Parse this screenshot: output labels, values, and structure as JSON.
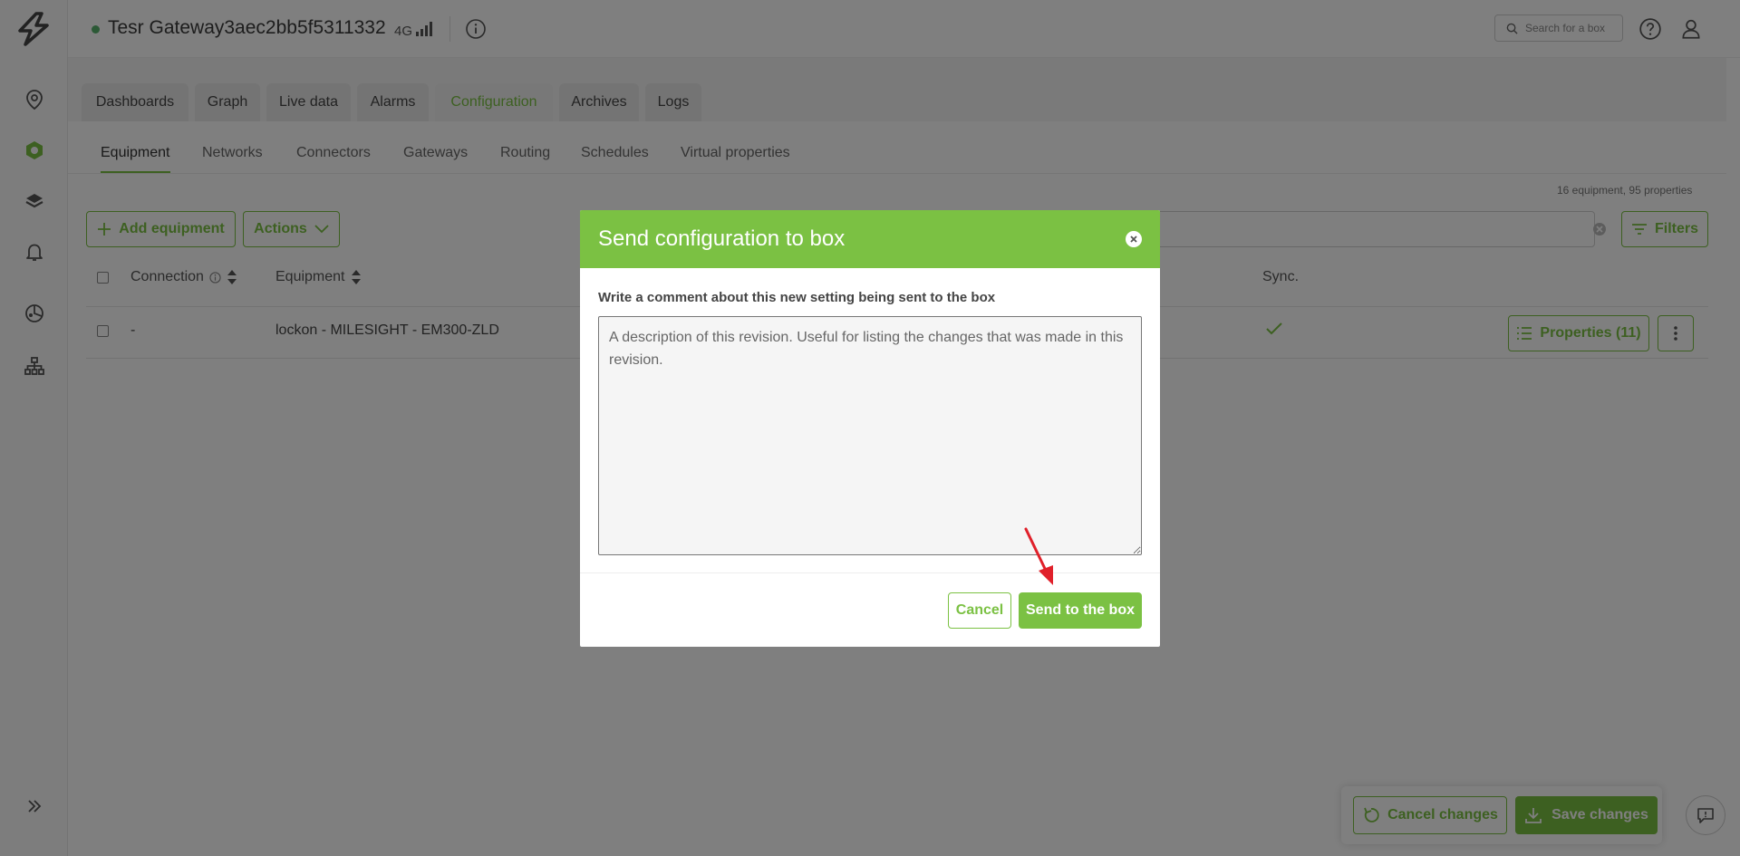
{
  "header": {
    "gateway_name": "Tesr Gateway3aec2bb5f5311332",
    "network": "4G",
    "search_placeholder": "Search for a box"
  },
  "main_tabs": [
    {
      "label": "Dashboards"
    },
    {
      "label": "Graph"
    },
    {
      "label": "Live data"
    },
    {
      "label": "Alarms"
    },
    {
      "label": "Configuration"
    },
    {
      "label": "Archives"
    },
    {
      "label": "Logs"
    }
  ],
  "sub_tabs": [
    {
      "label": "Equipment"
    },
    {
      "label": "Networks"
    },
    {
      "label": "Connectors"
    },
    {
      "label": "Gateways"
    },
    {
      "label": "Routing"
    },
    {
      "label": "Schedules"
    },
    {
      "label": "Virtual properties"
    }
  ],
  "summary": "16 equipment, 95 properties",
  "toolbar": {
    "add_label": "Add equipment",
    "actions_label": "Actions",
    "filters_label": "Filters"
  },
  "table": {
    "columns": {
      "connection": "Connection",
      "equipment": "Equipment",
      "sync": "Sync."
    },
    "rows": [
      {
        "connection": "-",
        "equipment": "lockon - MILESIGHT - EM300-ZLD",
        "properties_label": "Properties (11)"
      }
    ]
  },
  "footer": {
    "cancel_changes": "Cancel changes",
    "save_changes": "Save changes"
  },
  "modal": {
    "title": "Send configuration to box",
    "label": "Write a comment about this new setting being sent to the box",
    "placeholder": "A description of this revision. Useful for listing the changes that was made in this revision.",
    "cancel": "Cancel",
    "send": "Send to the box"
  },
  "colors": {
    "accent": "#7bc143",
    "status": "#58b26c",
    "arrow": "#e0202a"
  }
}
